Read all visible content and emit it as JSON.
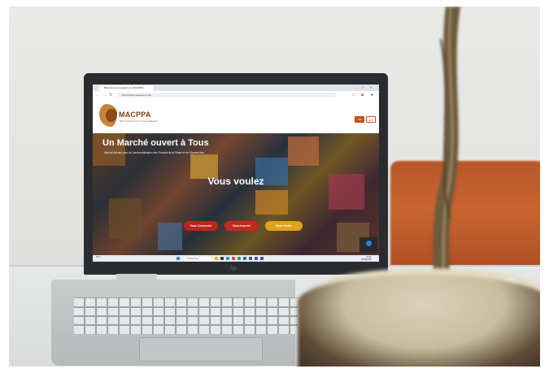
{
  "browser": {
    "tab_title": "Bienvenue à la plateforme MACPPA",
    "url": "https://www.macppa.com/fr"
  },
  "site": {
    "logo_name": "MACPPA",
    "logo_tagline": "Marché Africain pour la Commercialisation",
    "header_buttons": [
      "FR",
      "EN"
    ]
  },
  "hero": {
    "title": "Un Marché ouvert à Tous",
    "subtitle": "Marché Africain pour la Commercialisation des Produits de la Pêche et de l'Aquaculture",
    "headline": "Vous voulez",
    "buttons": [
      "Vous Connecter",
      "Vous Inscrire",
      "Nous Visiter"
    ],
    "button_colors": [
      "#b8261c",
      "#c02a1f",
      "#e0a21c"
    ]
  },
  "taskbar": {
    "weather": "30°C",
    "search_placeholder": "Rechercher",
    "time": "14:05",
    "date": "02/08/2024"
  },
  "laptop": {
    "brand": "hp"
  },
  "colors": {
    "brand": "#7a3e16",
    "chair": "#c8652f"
  }
}
